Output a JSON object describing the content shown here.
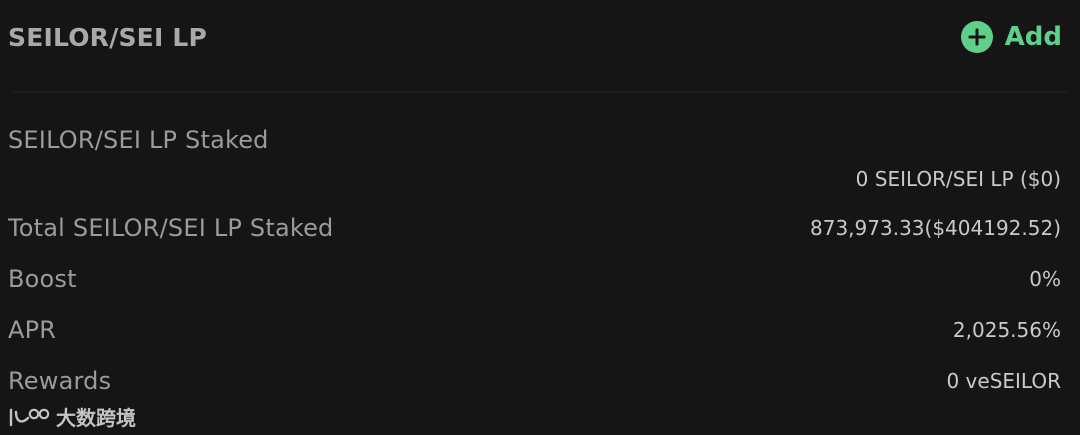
{
  "header": {
    "title": "SEILOR/SEI LP",
    "add_label": "Add",
    "add_icon": "plus-circle-icon",
    "accent_color": "#5fcf8c"
  },
  "stats": {
    "staked_label": "SEILOR/SEI LP Staked",
    "staked_value": "0 SEILOR/SEI LP ($0)",
    "total_staked_label": "Total SEILOR/SEI LP Staked",
    "total_staked_value": "873,973.33($404192.52)",
    "boost_label": "Boost",
    "boost_value": "0%",
    "apr_label": "APR",
    "apr_value": "2,025.56%",
    "rewards_label": "Rewards",
    "rewards_value": "0 veSEILOR"
  },
  "watermark": {
    "text": "大数跨境",
    "logo": "100"
  }
}
